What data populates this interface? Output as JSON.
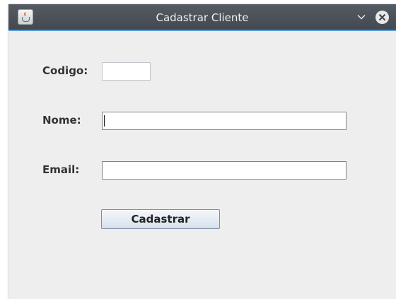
{
  "window": {
    "title": "Cadastrar Cliente"
  },
  "form": {
    "codigo": {
      "label": "Codigo:",
      "value": ""
    },
    "nome": {
      "label": "Nome:",
      "value": ""
    },
    "email": {
      "label": "Email:",
      "value": ""
    },
    "submit_label": "Cadastrar"
  },
  "icons": {
    "app": "java-app-icon",
    "minimize": "chevron-down-icon",
    "close": "close-icon"
  },
  "colors": {
    "titlebar": "#4a5057",
    "titlebar_accent": "#5b9bd5",
    "window_background": "#eeeeee"
  }
}
